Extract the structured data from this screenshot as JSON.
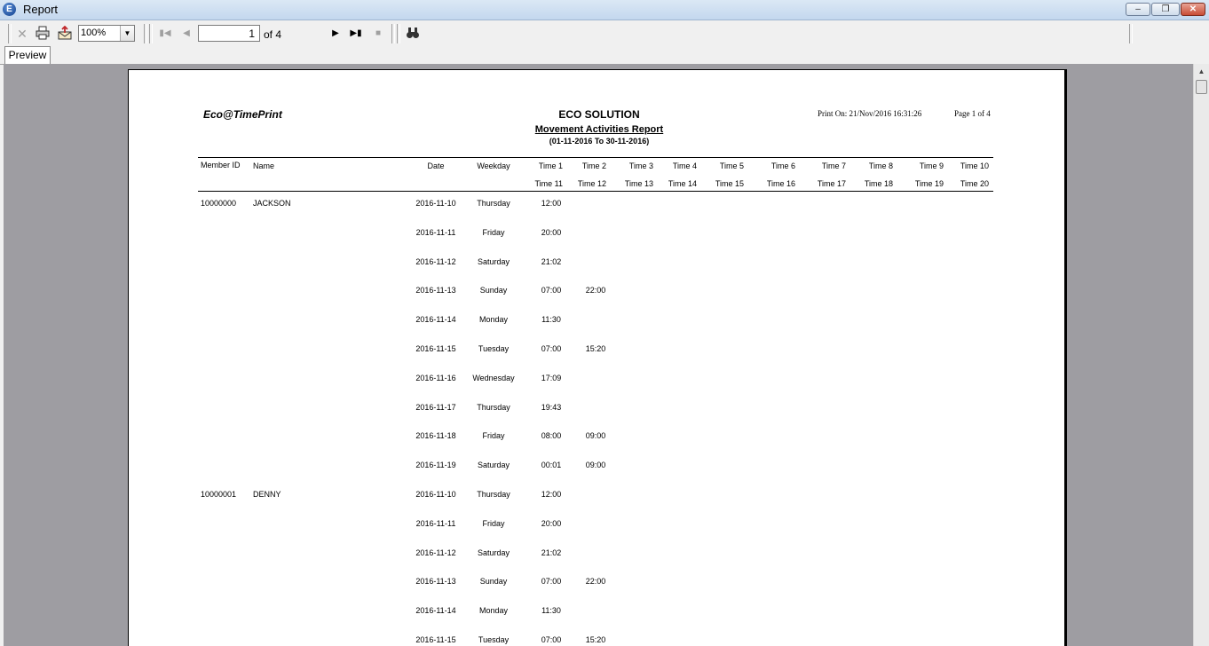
{
  "window": {
    "title": "Report",
    "app_icon_letter": "E",
    "controls": [
      "minimize",
      "restore",
      "close"
    ]
  },
  "toolbar": {
    "zoom": "100%",
    "page_current": "1",
    "page_of": "of 4",
    "icons": [
      "close-icon",
      "print-icon",
      "export-icon",
      "first-page-icon",
      "prev-page-icon",
      "next-page-icon",
      "last-page-icon",
      "stop-icon",
      "find-icon"
    ]
  },
  "tabs": {
    "preview": "Preview"
  },
  "report": {
    "brand": "Eco@TimePrint",
    "company": "ECO SOLUTION",
    "title": "Movement Activities Report",
    "range": "(01-11-2016 To 30-11-2016)",
    "print_on": "Print On: 21/Nov/2016 16:31:26",
    "page_label": "Page 1 of 4",
    "headers": {
      "member_id": "Member ID",
      "name": "Name",
      "date": "Date",
      "weekday": "Weekday",
      "times_row1": [
        "Time 1",
        "Time 2",
        "Time 3",
        "Time 4",
        "Time 5",
        "Time 6",
        "Time 7",
        "Time 8",
        "Time 9",
        "Time 10"
      ],
      "times_row2": [
        "Time 11",
        "Time 12",
        "Time 13",
        "Time 14",
        "Time 15",
        "Time 16",
        "Time 17",
        "Time 18",
        "Time 19",
        "Time 20"
      ]
    },
    "rows": [
      {
        "member_id": "10000000",
        "name": "JACKSON",
        "date": "2016-11-10",
        "weekday": "Thursday",
        "t1": "12:00",
        "t2": ""
      },
      {
        "member_id": "",
        "name": "",
        "date": "2016-11-11",
        "weekday": "Friday",
        "t1": "20:00",
        "t2": ""
      },
      {
        "member_id": "",
        "name": "",
        "date": "2016-11-12",
        "weekday": "Saturday",
        "t1": "21:02",
        "t2": ""
      },
      {
        "member_id": "",
        "name": "",
        "date": "2016-11-13",
        "weekday": "Sunday",
        "t1": "07:00",
        "t2": "22:00"
      },
      {
        "member_id": "",
        "name": "",
        "date": "2016-11-14",
        "weekday": "Monday",
        "t1": "11:30",
        "t2": ""
      },
      {
        "member_id": "",
        "name": "",
        "date": "2016-11-15",
        "weekday": "Tuesday",
        "t1": "07:00",
        "t2": "15:20"
      },
      {
        "member_id": "",
        "name": "",
        "date": "2016-11-16",
        "weekday": "Wednesday",
        "t1": "17:09",
        "t2": ""
      },
      {
        "member_id": "",
        "name": "",
        "date": "2016-11-17",
        "weekday": "Thursday",
        "t1": "19:43",
        "t2": ""
      },
      {
        "member_id": "",
        "name": "",
        "date": "2016-11-18",
        "weekday": "Friday",
        "t1": "08:00",
        "t2": "09:00"
      },
      {
        "member_id": "",
        "name": "",
        "date": "2016-11-19",
        "weekday": "Saturday",
        "t1": "00:01",
        "t2": "09:00"
      },
      {
        "member_id": "10000001",
        "name": "DENNY",
        "date": "2016-11-10",
        "weekday": "Thursday",
        "t1": "12:00",
        "t2": ""
      },
      {
        "member_id": "",
        "name": "",
        "date": "2016-11-11",
        "weekday": "Friday",
        "t1": "20:00",
        "t2": ""
      },
      {
        "member_id": "",
        "name": "",
        "date": "2016-11-12",
        "weekday": "Saturday",
        "t1": "21:02",
        "t2": ""
      },
      {
        "member_id": "",
        "name": "",
        "date": "2016-11-13",
        "weekday": "Sunday",
        "t1": "07:00",
        "t2": "22:00"
      },
      {
        "member_id": "",
        "name": "",
        "date": "2016-11-14",
        "weekday": "Monday",
        "t1": "11:30",
        "t2": ""
      },
      {
        "member_id": "",
        "name": "",
        "date": "2016-11-15",
        "weekday": "Tuesday",
        "t1": "07:00",
        "t2": "15:20"
      }
    ]
  }
}
